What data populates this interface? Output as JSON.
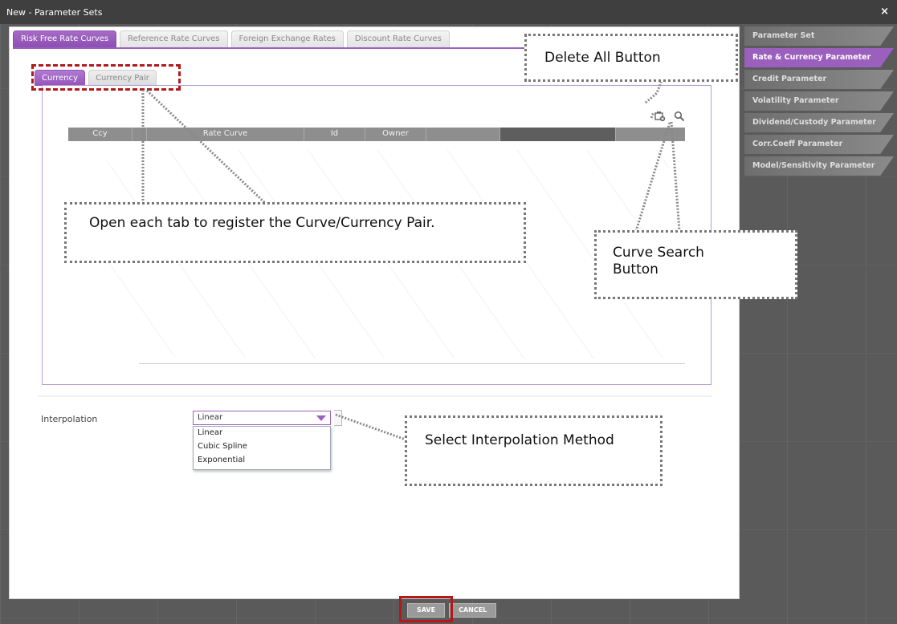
{
  "window": {
    "title": "New - Parameter Sets",
    "close_label": "×"
  },
  "top_tabs": [
    {
      "label": "Risk Free Rate Curves",
      "active": true
    },
    {
      "label": "Reference Rate Curves",
      "active": false
    },
    {
      "label": "Foreign Exchange Rates",
      "active": false
    },
    {
      "label": "Discount Rate Curves",
      "active": false
    }
  ],
  "sub_tabs": [
    {
      "label": "Currency",
      "active": true
    },
    {
      "label": "Currency Pair",
      "active": false
    }
  ],
  "grid": {
    "columns": [
      "Ccy",
      "Rate Curve",
      "Id",
      "Owner"
    ],
    "toolbar": {
      "delete_all_icon": "delete-all-icon",
      "search_icon": "search-icon"
    }
  },
  "interpolation": {
    "label": "Interpolation",
    "selected": "Linear",
    "options": [
      "Linear",
      "Cubic Spline",
      "Exponential"
    ]
  },
  "right_nav": [
    {
      "label": "Parameter Set",
      "active": false
    },
    {
      "label": "Rate & Currency Parameter",
      "active": true
    },
    {
      "label": "Credit Parameter",
      "active": false
    },
    {
      "label": "Volatility Parameter",
      "active": false
    },
    {
      "label": "Dividend/Custody Parameter",
      "active": false
    },
    {
      "label": "Corr.Coeff Parameter",
      "active": false
    },
    {
      "label": "Model/Sensitivity Parameter",
      "active": false
    }
  ],
  "footer": {
    "save_label": "SAVE",
    "cancel_label": "CANCEL"
  },
  "annotations": {
    "delete_all": "Delete All Button",
    "tabs_note": "Open each tab to register the Curve/Currency Pair.",
    "curve_search": "Curve Search Button",
    "interpolation_note": "Select Interpolation Method"
  },
  "colors": {
    "accent": "#9b5fbe",
    "highlight_red": "#b31919"
  }
}
